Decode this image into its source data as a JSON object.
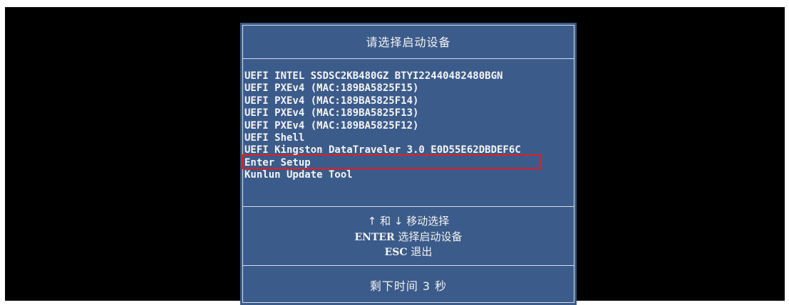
{
  "dialog": {
    "title": "请选择启动设备",
    "boot_items": [
      "UEFI INTEL SSDSC2KB480GZ BTYI22440482480BGN",
      "UEFI PXEv4 (MAC:189BA5825F15)",
      "UEFI PXEv4 (MAC:189BA5825F14)",
      "UEFI PXEv4 (MAC:189BA5825F13)",
      "UEFI PXEv4 (MAC:189BA5825F12)",
      "UEFI Shell",
      "UEFI Kingston DataTraveler 3.0 E0D55E62DBDEF6C",
      "Enter Setup",
      "Kunlun Update Tool"
    ],
    "selected_index": 6,
    "help": {
      "line1": "↑ 和 ↓ 移动选择",
      "line2_key": "ENTER",
      "line2_text": " 选择启动设备",
      "line3_key": "ESC",
      "line3_text": " 退出"
    },
    "countdown": "剩下时间 3 秒"
  },
  "colors": {
    "screen_bg": "#000000",
    "dialog_bg": "#3b5b8a",
    "text": "#f4f4f4",
    "highlight_border": "#e0201e"
  }
}
